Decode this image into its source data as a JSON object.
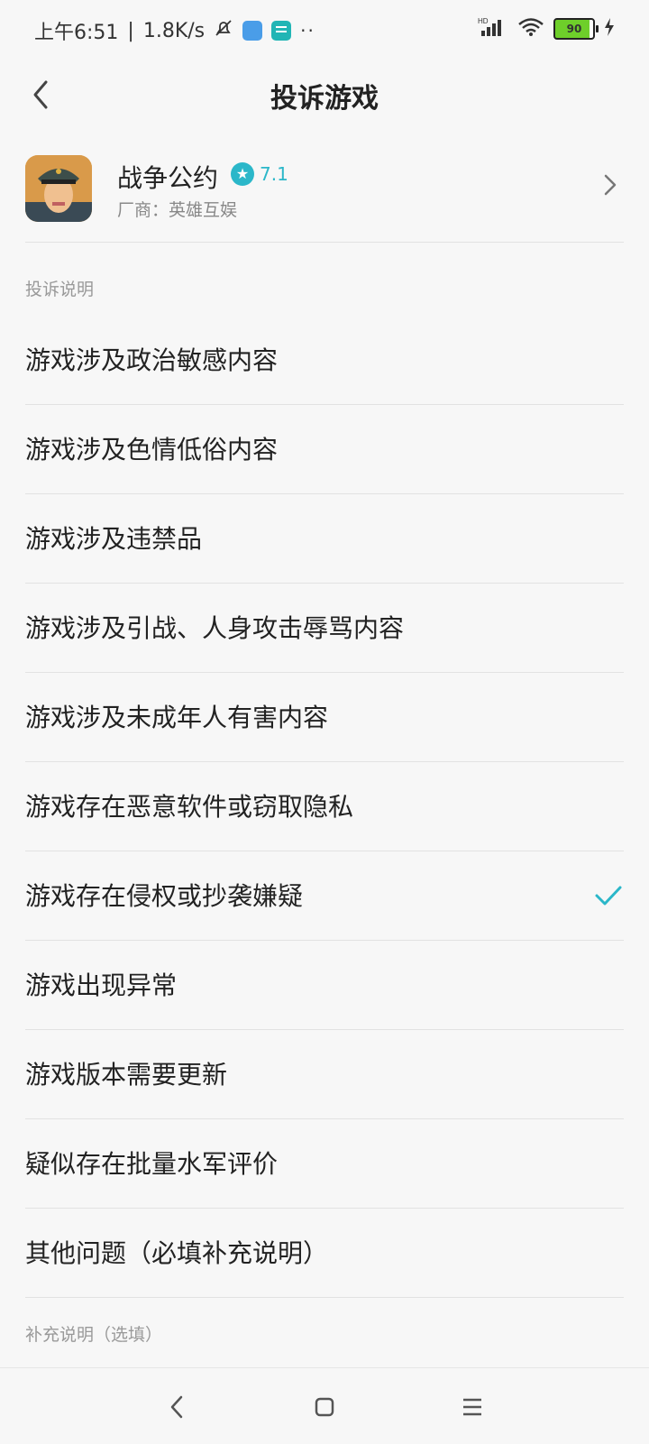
{
  "status_bar": {
    "time": "上午6:51",
    "network_speed": "1.8K/s",
    "battery": "90",
    "signal_label": "HD"
  },
  "header": {
    "title": "投诉游戏"
  },
  "app": {
    "name": "战争公约",
    "rating": "7.1",
    "developer": "厂商：英雄互娱",
    "accent_color": "#2bb7c9"
  },
  "section_1_title": "投诉说明",
  "options": [
    {
      "label": "游戏涉及政治敏感内容"
    },
    {
      "label": "游戏涉及色情低俗内容"
    },
    {
      "label": "游戏涉及违禁品"
    },
    {
      "label": "游戏涉及引战、人身攻击辱骂内容"
    },
    {
      "label": "游戏涉及未成年人有害内容"
    },
    {
      "label": "游戏存在恶意软件或窃取隐私"
    },
    {
      "label": "游戏存在侵权或抄袭嫌疑"
    },
    {
      "label": "游戏出现异常"
    },
    {
      "label": "游戏版本需要更新"
    },
    {
      "label": "疑似存在批量水军评价"
    },
    {
      "label": "其他问题（必填补充说明）"
    }
  ],
  "selected_option": "游戏存在侵权或抄袭嫌疑",
  "section_2_title": "补充说明（选填）",
  "icons": {
    "back": "back-arrow-icon",
    "chevron": "chevron-right-icon",
    "check": "check-icon",
    "star": "star-icon"
  }
}
